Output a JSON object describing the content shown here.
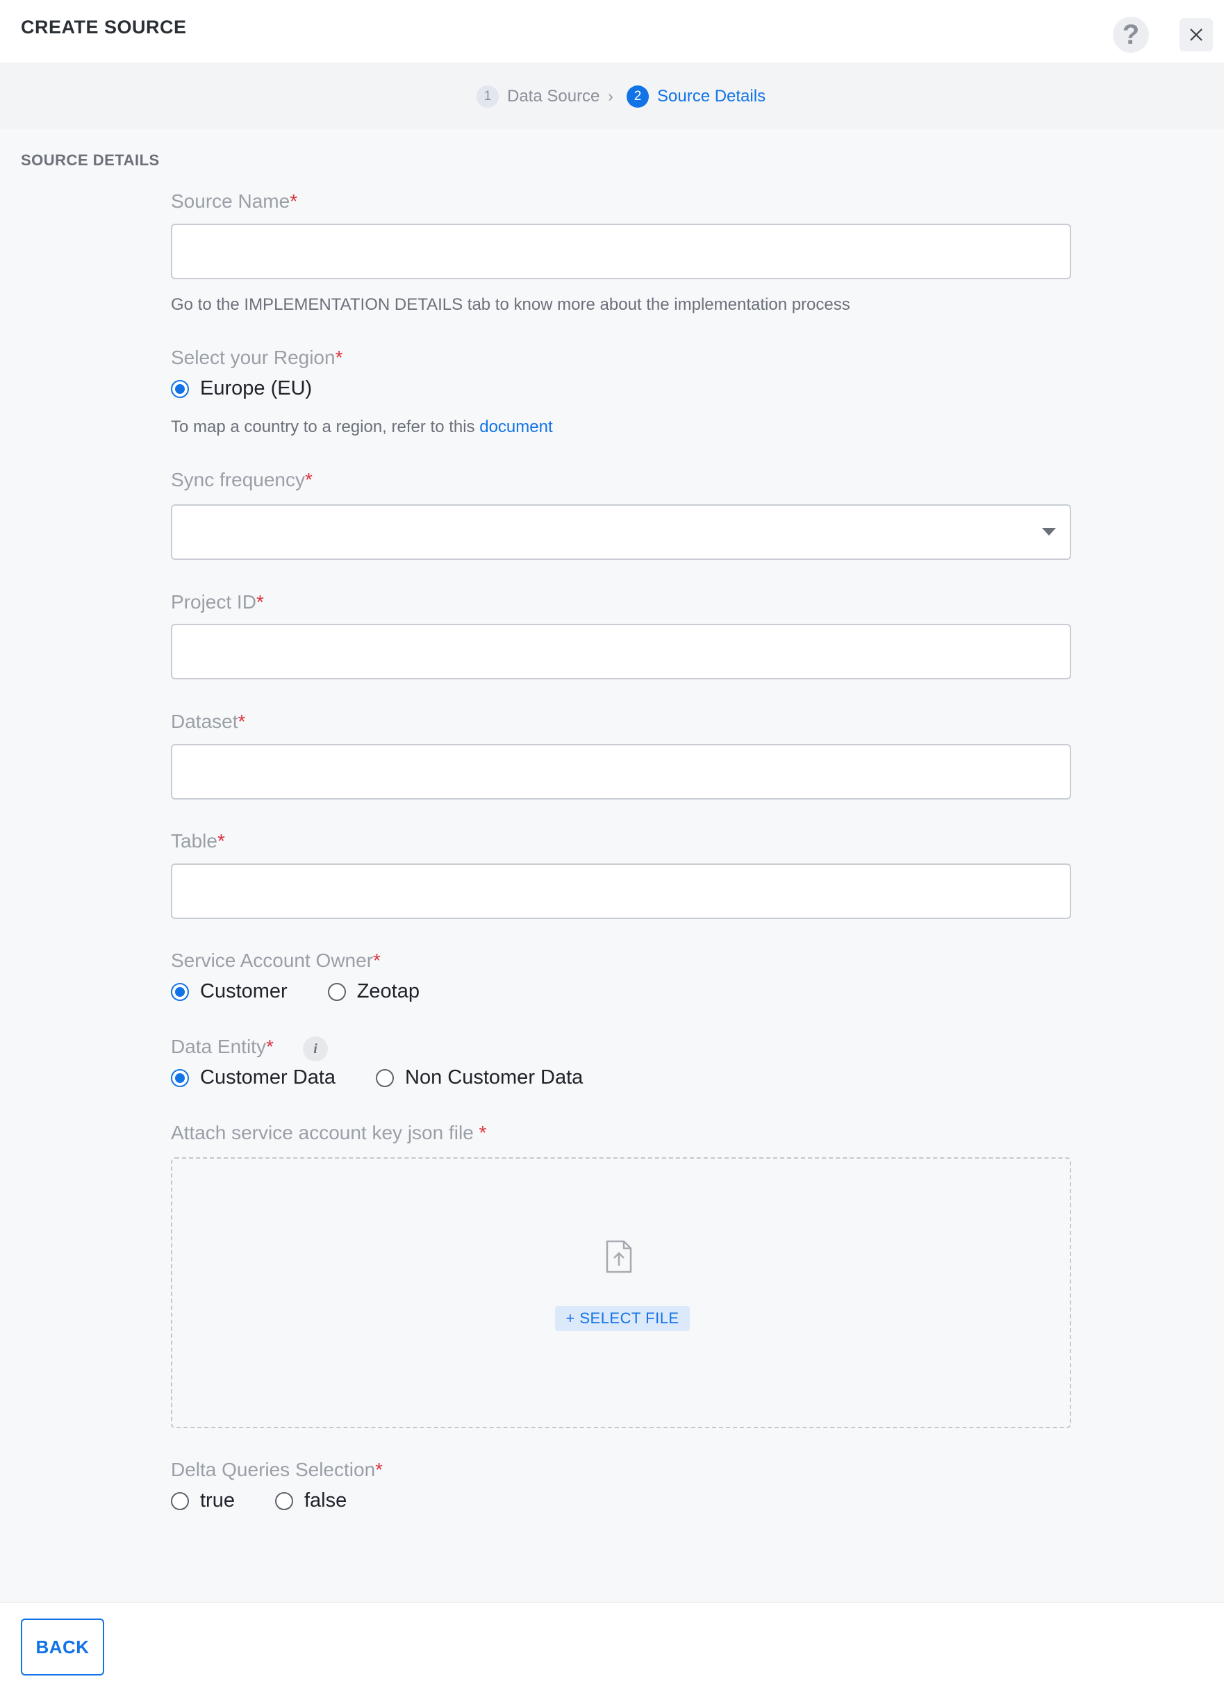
{
  "header": {
    "title": "CREATE SOURCE",
    "help_label": "?",
    "help_icon": "question-icon",
    "close_icon": "close-icon"
  },
  "stepper": {
    "steps": [
      {
        "number": "1",
        "label": "Data Source",
        "state": "completed"
      },
      {
        "number": "2",
        "label": "Source Details",
        "state": "active"
      }
    ],
    "separator": "›"
  },
  "section": {
    "title": "SOURCE DETAILS"
  },
  "form": {
    "source_name": {
      "label": "Source Name",
      "required": "*",
      "value": ""
    },
    "implementation_hint": "Go to the IMPLEMENTATION DETAILS tab to know more about the implementation process",
    "region": {
      "label": "Select your Region",
      "required": "*",
      "options": [
        {
          "label": "Europe (EU)",
          "checked": true
        }
      ],
      "hint_prefix": "To map a country to a region, refer to this",
      "hint_link": "document"
    },
    "sync_frequency": {
      "label": "Sync frequency",
      "required": "*",
      "value": ""
    },
    "project_id": {
      "label": "Project ID",
      "required": "*",
      "value": ""
    },
    "dataset": {
      "label": "Dataset",
      "required": "*",
      "value": ""
    },
    "table": {
      "label": "Table",
      "required": "*",
      "value": ""
    },
    "service_account_owner": {
      "label": "Service Account Owner",
      "required": "*",
      "options": [
        {
          "label": "Customer",
          "checked": true
        },
        {
          "label": "Zeotap",
          "checked": false
        }
      ]
    },
    "data_entity": {
      "label": "Data Entity",
      "required": "*",
      "info": "i",
      "options": [
        {
          "label": "Customer Data",
          "checked": true
        },
        {
          "label": "Non Customer Data",
          "checked": false
        }
      ]
    },
    "attach_file": {
      "label": "Attach service account key json file",
      "required": "*",
      "button": "+ SELECT FILE",
      "icon": "file-upload-icon"
    },
    "delta_queries": {
      "label": "Delta Queries Selection",
      "required": "*",
      "options": [
        {
          "label": "true",
          "checked": false
        },
        {
          "label": "false",
          "checked": false
        }
      ]
    }
  },
  "footer": {
    "back_label": "BACK"
  },
  "colors": {
    "accent": "#1173e6",
    "required": "#d9363e",
    "label": "#9a9fa7",
    "background": "#f7f8fa"
  }
}
